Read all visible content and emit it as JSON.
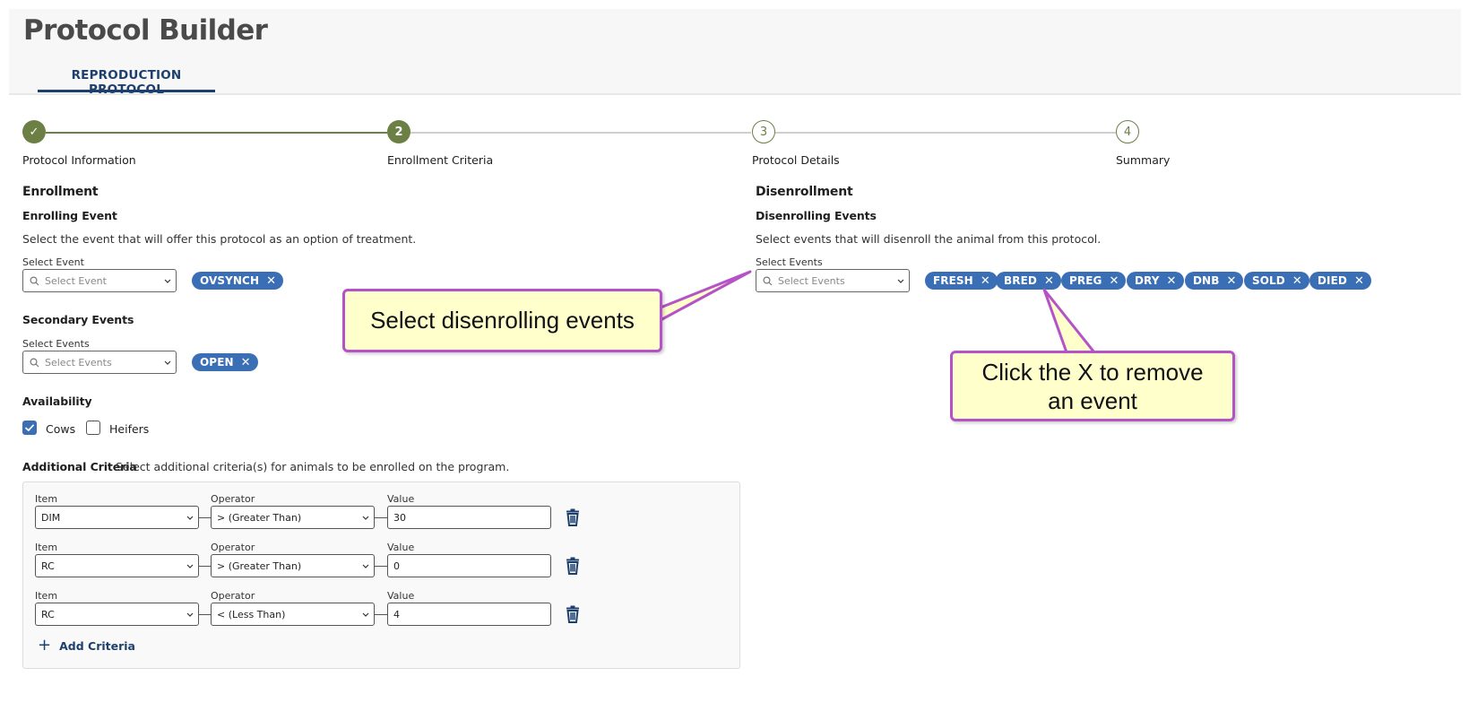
{
  "page": {
    "title": "Protocol Builder",
    "tab": "REPRODUCTION PROTOCOL"
  },
  "stepper": {
    "steps": [
      {
        "label": "Protocol Information",
        "marker": "✓",
        "state": "complete"
      },
      {
        "label": "Enrollment Criteria",
        "marker": "2",
        "state": "active"
      },
      {
        "label": "Protocol Details",
        "marker": "3",
        "state": "pending"
      },
      {
        "label": "Summary",
        "marker": "4",
        "state": "pending"
      }
    ]
  },
  "enrollment": {
    "heading": "Enrollment",
    "enrolling_event": {
      "label": "Enrolling Event",
      "description": "Select the event that will offer this protocol as an option of treatment.",
      "field_label": "Select Event",
      "placeholder": "Select Event",
      "chips": [
        "OVSYNCH"
      ]
    },
    "secondary_events": {
      "label": "Secondary Events",
      "field_label": "Select Events",
      "placeholder": "Select Events",
      "chips": [
        "OPEN"
      ]
    },
    "availability": {
      "label": "Availability",
      "options": [
        {
          "label": "Cows",
          "checked": true
        },
        {
          "label": "Heifers",
          "checked": false
        }
      ]
    },
    "additional_criteria": {
      "label": "Additional Criteria",
      "description": "Select additional criteria(s) for animals to be enrolled on the program.",
      "item_label": "Item",
      "operator_label": "Operator",
      "value_label": "Value",
      "rows": [
        {
          "item": "DIM",
          "operator": "> (Greater Than)",
          "value": "30"
        },
        {
          "item": "RC",
          "operator": "> (Greater Than)",
          "value": "0"
        },
        {
          "item": "RC",
          "operator": "< (Less Than)",
          "value": "4"
        }
      ],
      "add_label": "Add Criteria"
    }
  },
  "disenrollment": {
    "heading": "Disenrollment",
    "label": "Disenrolling Events",
    "description": "Select events that will disenroll the animal from this protocol.",
    "field_label": "Select Events",
    "placeholder": "Select Events",
    "chips": [
      "FRESH",
      "BRED",
      "PREG",
      "DRY",
      "DNB",
      "SOLD",
      "DIED"
    ]
  },
  "callouts": {
    "select_disenrolling": "Select disenrolling events",
    "remove_event_line1": "Click the X to remove",
    "remove_event_line2": "an event"
  },
  "colors": {
    "primary_blue": "#3b6fb5",
    "navy": "#1d3f6e",
    "step_green": "#6c7f45",
    "callout_fill": "#ffffcc",
    "callout_border": "#b552c8"
  },
  "icons": {
    "search": "search-icon",
    "chevron": "chevron-down-icon",
    "remove": "close-icon",
    "delete": "trash-icon",
    "add": "plus-icon",
    "check": "checkmark-icon"
  }
}
